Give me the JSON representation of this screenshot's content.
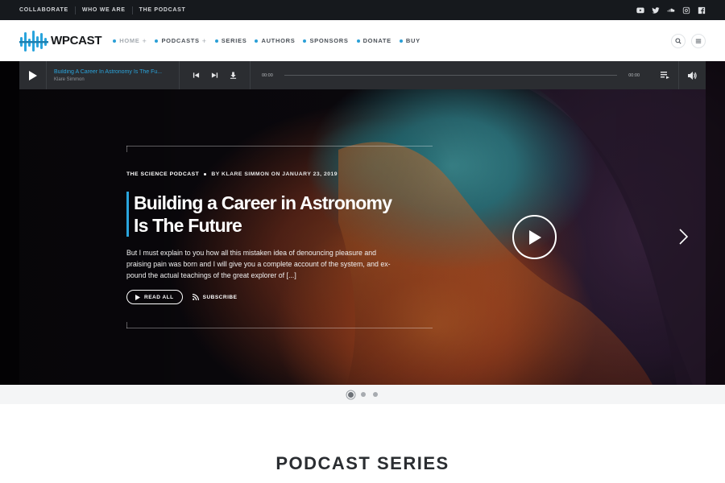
{
  "topbar": {
    "links": [
      "COLLABORATE",
      "WHO WE ARE",
      "THE PODCAST"
    ],
    "social_icons": [
      "youtube-icon",
      "twitter-icon",
      "soundcloud-icon",
      "instagram-icon",
      "facebook-icon"
    ]
  },
  "header": {
    "logo_text": "WPCAST",
    "nav": [
      {
        "label": "HOME",
        "has_plus": true,
        "active": true
      },
      {
        "label": "PODCASTS",
        "has_plus": true,
        "active": false
      },
      {
        "label": "SERIES",
        "has_plus": false,
        "active": false
      },
      {
        "label": "AUTHORS",
        "has_plus": false,
        "active": false
      },
      {
        "label": "SPONSORS",
        "has_plus": false,
        "active": false
      },
      {
        "label": "DONATE",
        "has_plus": false,
        "active": false
      },
      {
        "label": "BUY",
        "has_plus": false,
        "active": false
      }
    ],
    "plus_symbol": "+",
    "accent_color": "#2a9fd6"
  },
  "player": {
    "track_title": "Building A Career In Astronomy Is The Fu...",
    "track_author": "Klare Simmon",
    "time_current": "00:00",
    "time_total": "00:00",
    "progress": 0
  },
  "hero": {
    "category": "THE SCIENCE PODCAST",
    "byline": "BY KLARE SIMMON ON JANUARY 23, 2019",
    "title": "Building a Career in Astronomy Is The Future",
    "excerpt": "But I must explain to you how all this mistaken idea of denouncing pleasure and praising pain was born and I will give you a complete account of the system, and ex-pound the actual teachings of the great explorer of [...]",
    "read_label": "READ ALL",
    "subscribe_label": "SUBSCRIBE"
  },
  "slider": {
    "dots": 3,
    "active_dot": 0
  },
  "section": {
    "title": "PODCAST SERIES"
  }
}
